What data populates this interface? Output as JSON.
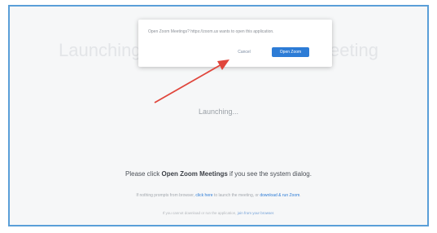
{
  "page": {
    "background_header_left": "Launching Me",
    "background_header_right": "ar Meeting",
    "launching_text": "Launching...",
    "instruction_prefix": "Please click ",
    "instruction_bold": "Open Zoom Meetings",
    "instruction_suffix": " if you see the system dialog.",
    "links_prefix": "If nothing prompts from browser, ",
    "links_click_here": "click here",
    "links_middle": " to launch the meeting, or ",
    "links_download": "download & run Zoom",
    "links_suffix": ".",
    "footer_prefix": "If you cannot download or run the application, ",
    "footer_link": "join from your browser",
    "footer_suffix": "."
  },
  "dialog": {
    "message": "Open Zoom Meetings?  https://zoom.us wants to open this application.",
    "cancel_label": "Cancel",
    "open_label": "Open Zoom Meetings"
  },
  "colors": {
    "frame_border": "#5a9fd8",
    "primary_blue": "#2d7cd6",
    "arrow_red": "#e0463c"
  }
}
